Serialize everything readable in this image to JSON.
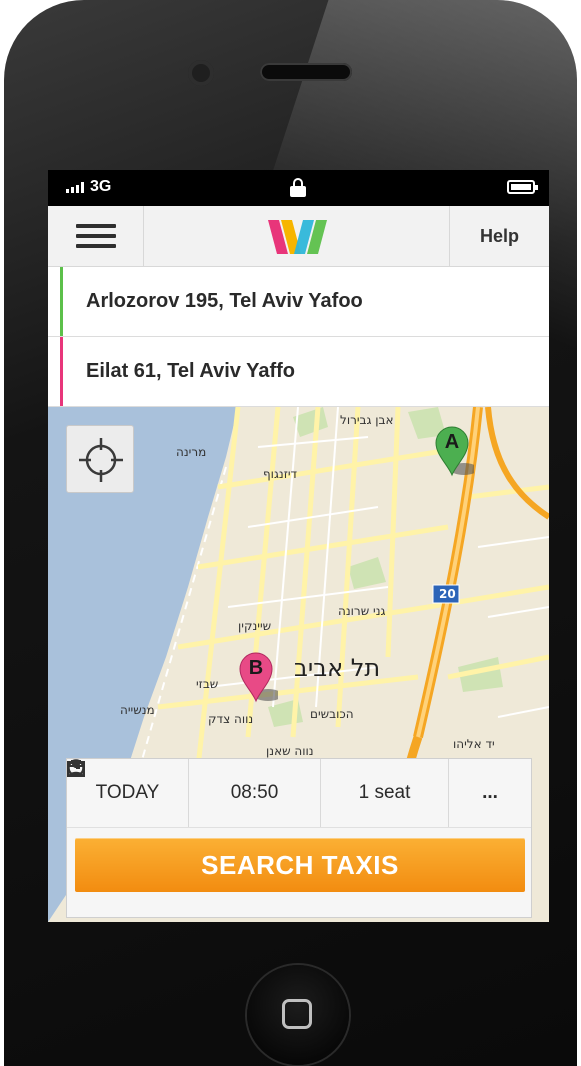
{
  "status_bar": {
    "network": "3G"
  },
  "app_bar": {
    "help_label": "Help",
    "logo_colors": [
      "#e8357a",
      "#f7b500",
      "#2eb6d9",
      "#5cc04a"
    ]
  },
  "route": {
    "from": {
      "address": "Arlozorov 195, Tel Aviv Yafoo",
      "color": "#5cc04a"
    },
    "to": {
      "address": "Eilat 61, Tel Aviv Yaffo",
      "color": "#e8357a"
    }
  },
  "map": {
    "labels": {
      "marina": "מרינה",
      "gani_sharona": "גני שרונה",
      "tel_aviv": "תל אביב",
      "shabazi": "שבזי",
      "manshiya": "מנשייה",
      "neve_tzedek": "נווה צדק",
      "neve_shaanan": "נווה שאנן",
      "shenkin": "שיינקין",
      "yad_eliyahu": "יד אליהו",
      "hakovshim": "הכובשים",
      "ibn_gvirol": "אבן גבירול",
      "dizengoff": "דיזנגוף",
      "highway_20": "20"
    },
    "pins": [
      {
        "letter": "A",
        "color": "#4caf50"
      },
      {
        "letter": "B",
        "color": "#e84a86"
      }
    ]
  },
  "trip_options": {
    "date_label": "TODAY",
    "time_label": "08:50",
    "seats_label": "1 seat",
    "more_label": "..."
  },
  "search_button_label": "SEARCH TAXIS",
  "accent": {
    "search_button": "#f5a020",
    "water": "#a9c1db"
  }
}
